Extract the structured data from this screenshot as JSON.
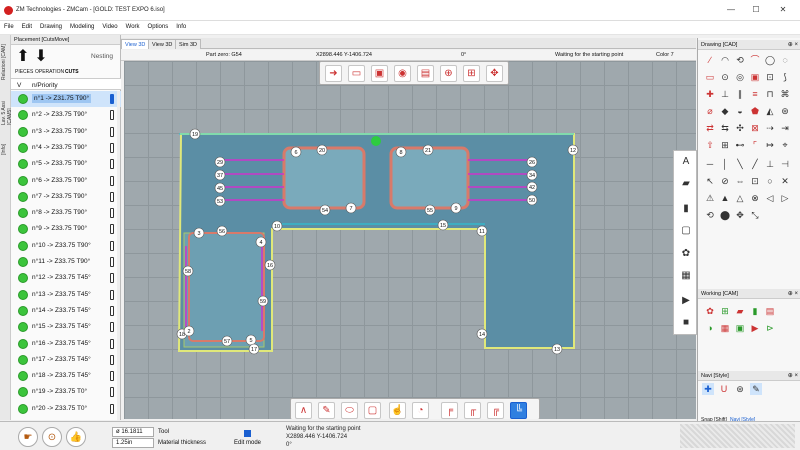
{
  "window": {
    "title": "ZM Technologies - ZMCam - [GOLD: TEST EXPO 6.iso]",
    "controls": [
      "—",
      "☐",
      "✕"
    ]
  },
  "menu": [
    "File",
    "Edit",
    "Drawing",
    "Modeling",
    "Video",
    "Work",
    "Options",
    "Info"
  ],
  "vertical_tabs": [
    "Relazioni [CAM]",
    "Lav. 5 Assi [CAM5]",
    "[Info]"
  ],
  "left_panel": {
    "title": "Placement [CutsMove]",
    "nesting_label": "Nesting",
    "tabs": [
      "PIECES",
      "OPERATION",
      "CUTS"
    ],
    "col_check": "V",
    "col_priority": "n/Priority",
    "items": [
      {
        "label": "n°1 -> Z31.75 T90°",
        "selected": true
      },
      {
        "label": "n°2 -> Z33.75 T90°"
      },
      {
        "label": "n°3 -> Z33.75 T90°"
      },
      {
        "label": "n°4 -> Z33.75 T90°"
      },
      {
        "label": "n°5 -> Z33.75 T90°"
      },
      {
        "label": "n°6 -> Z33.75 T90°"
      },
      {
        "label": "n°7 -> Z33.75 T90°"
      },
      {
        "label": "n°8 -> Z33.75 T90°"
      },
      {
        "label": "n°9 -> Z33.75 T90°"
      },
      {
        "label": "n°10 -> Z33.75 T90°"
      },
      {
        "label": "n°11 -> Z33.75 T90°"
      },
      {
        "label": "n°12 -> Z33.75 T45°"
      },
      {
        "label": "n°13 -> Z33.75 T45°"
      },
      {
        "label": "n°14 -> Z33.75 T45°"
      },
      {
        "label": "n°15 -> Z33.75 T45°"
      },
      {
        "label": "n°16 -> Z33.75 T45°"
      },
      {
        "label": "n°17 -> Z33.75 T45°"
      },
      {
        "label": "n°18 -> Z33.75 T45°"
      },
      {
        "label": "n°19 -> Z33.75 T0°"
      },
      {
        "label": "n°20 -> Z33.75 T0°"
      }
    ]
  },
  "view_tabs": [
    "View 3D",
    "View 3D",
    "Sim 3D"
  ],
  "info_bar": {
    "part": "Part zero: G54",
    "coords": "X2898.446 Y-1406.724",
    "angle": "0°",
    "message": "Waiting for the starting point",
    "color": "Color 7"
  },
  "labels_canvas": [
    "19",
    "12",
    "6",
    "20",
    "8",
    "21",
    "29",
    "37",
    "45",
    "53",
    "26",
    "34",
    "42",
    "50",
    "54",
    "7",
    "55",
    "9",
    "10",
    "15",
    "11",
    "3",
    "56",
    "4",
    "58",
    "16",
    "59",
    "18",
    "2",
    "57",
    "5",
    "17",
    "14",
    "13"
  ],
  "right_panel": {
    "drawing_title": "Drawing [CAD]",
    "working_title": "Working [CAM]",
    "navi_title": "Navi [Style]",
    "tabs": [
      "Snap [Shift]",
      "Navi [Style]"
    ]
  },
  "status": {
    "diameter": "ø 16.1811",
    "tool_label": "Tool",
    "thickness": "1.25in",
    "thickness_label": "Material thickness",
    "edit_label": "Edit mode",
    "msg1": "Waiting for the starting point",
    "msg2": "X2898.446 Y-1406.724",
    "msg3": "0°"
  },
  "colors": {
    "accent": "#1a5fd0",
    "selected_bg": "#cfe4fb",
    "piece": "#5b8ea5",
    "ok": "#3cc43c"
  }
}
